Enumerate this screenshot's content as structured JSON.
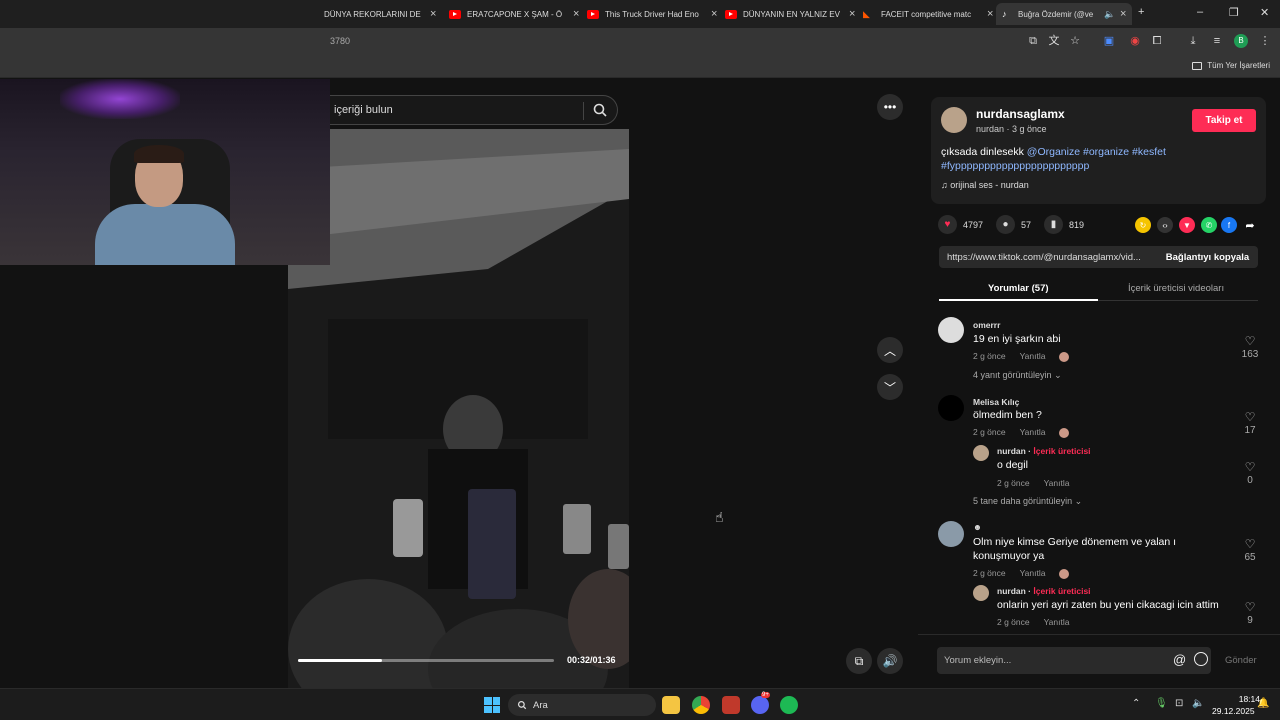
{
  "browser": {
    "tabs": [
      {
        "title": "DÜNYA REKORLARINI DE",
        "icon": "youtube-icon"
      },
      {
        "title": "ERA7CAPONE X ŞAM - Ö",
        "icon": "youtube-icon"
      },
      {
        "title": "This Truck Driver Had Eno",
        "icon": "youtube-icon"
      },
      {
        "title": "DÜNYANIN EN YALNIZ EV",
        "icon": "youtube-icon"
      },
      {
        "title": "FACEIT competitive matc",
        "icon": "faceit-icon"
      },
      {
        "title": "Buğra Özdemir (@ve",
        "icon": "tiktok-icon"
      }
    ],
    "url_fragment": "3780",
    "bookmarks_all": "Tüm Yer İşaretleri",
    "profile_initial": "B"
  },
  "search": {
    "placeholder": "içeriği bulun"
  },
  "video": {
    "time": "00:32/01:36",
    "progress": 0.33
  },
  "post": {
    "username": "nurdansaglamx",
    "nickname_line": "nurdan · 3 g önce",
    "follow_label": "Takip et",
    "desc_plain": "çıksada dinlesekk ",
    "desc_tags": "@Organize #organize #kesfet #fyppppppppppppppppppppppp",
    "sound": "orijinal ses - nurdan",
    "likes": "4797",
    "comments_count": "57",
    "saves": "819",
    "share_url": "https://www.tiktok.com/@nurdansaglamx/vid...",
    "copy_label": "Bağlantıyı kopyala",
    "tab_comments": "Yorumlar (57)",
    "tab_creator": "İçerik üreticisi videoları"
  },
  "comments": [
    {
      "user": "omerrr",
      "text": "19 en iyi şarkın abi",
      "time": "2 g önce",
      "reply": "Yanıtla",
      "likes": "163",
      "more": "4 yanıt görüntüleyin"
    },
    {
      "user": "Melisa Kılıç",
      "text": "ölmedim ben ?",
      "time": "2 g önce",
      "reply": "Yanıtla",
      "likes": "17"
    },
    {
      "user": "nurdan",
      "badge": "İçerik üreticisi",
      "text": "o degil",
      "time": "2 g önce",
      "reply": "Yanıtla",
      "likes": "0",
      "more": "5 tane daha görüntüleyin"
    },
    {
      "user": "",
      "text": "Olm niye kimse Geriye dönemem ve yalan ı konuşmuyor ya",
      "time": "2 g önce",
      "reply": "Yanıtla",
      "likes": "65"
    },
    {
      "user": "nurdan",
      "badge": "İçerik üreticisi",
      "text": "onlarin yeri ayri zaten bu yeni cikacagi icin attim",
      "time": "2 g önce",
      "reply": "Yanıtla",
      "likes": "9"
    }
  ],
  "comment_bar": {
    "placeholder": "Yorum ekleyin...",
    "send": "Gönder"
  },
  "taskbar": {
    "search": "Ara",
    "time": "18:14",
    "date": "29.12.2025",
    "badge_discord": "9+"
  },
  "colors": {
    "accent": "#fe2c55",
    "tag": "#8fb8ff",
    "win_accent": "#4cc2ff"
  }
}
